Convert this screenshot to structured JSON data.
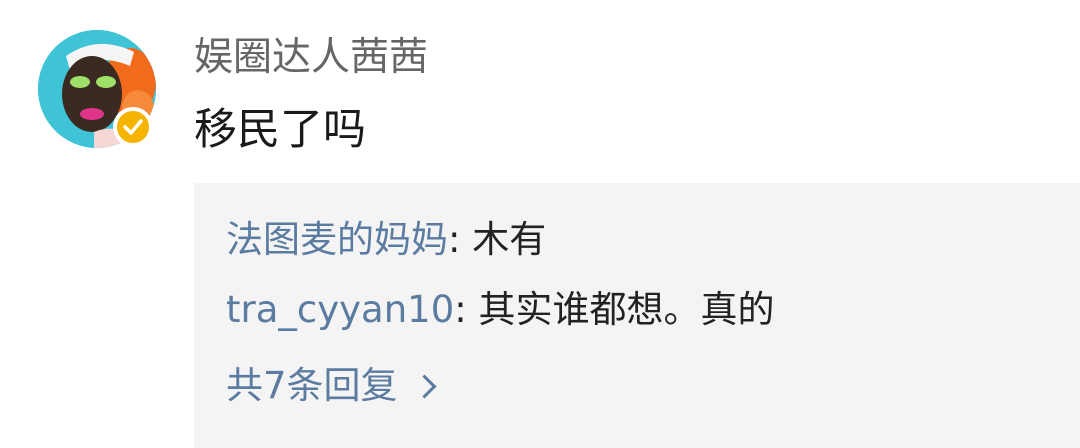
{
  "comment": {
    "username": "娱圈达人茜茜",
    "text": "移民了吗",
    "avatar_icon": "user-avatar",
    "verified_badge_icon": "verified-badge-icon",
    "verified_badge_color": "#f4b400"
  },
  "replies": [
    {
      "author": "法图麦的妈妈",
      "separator": ": ",
      "text": "木有"
    },
    {
      "author": "tra_cyyan10",
      "separator": ": ",
      "text": "其实谁都想。真的"
    }
  ],
  "view_all": {
    "label": "共7条回复",
    "icon": "chevron-right-icon"
  },
  "colors": {
    "link": "#5b7ba0",
    "reply_bg": "#f4f4f4",
    "username": "#666666",
    "text": "#1a1a1a"
  }
}
